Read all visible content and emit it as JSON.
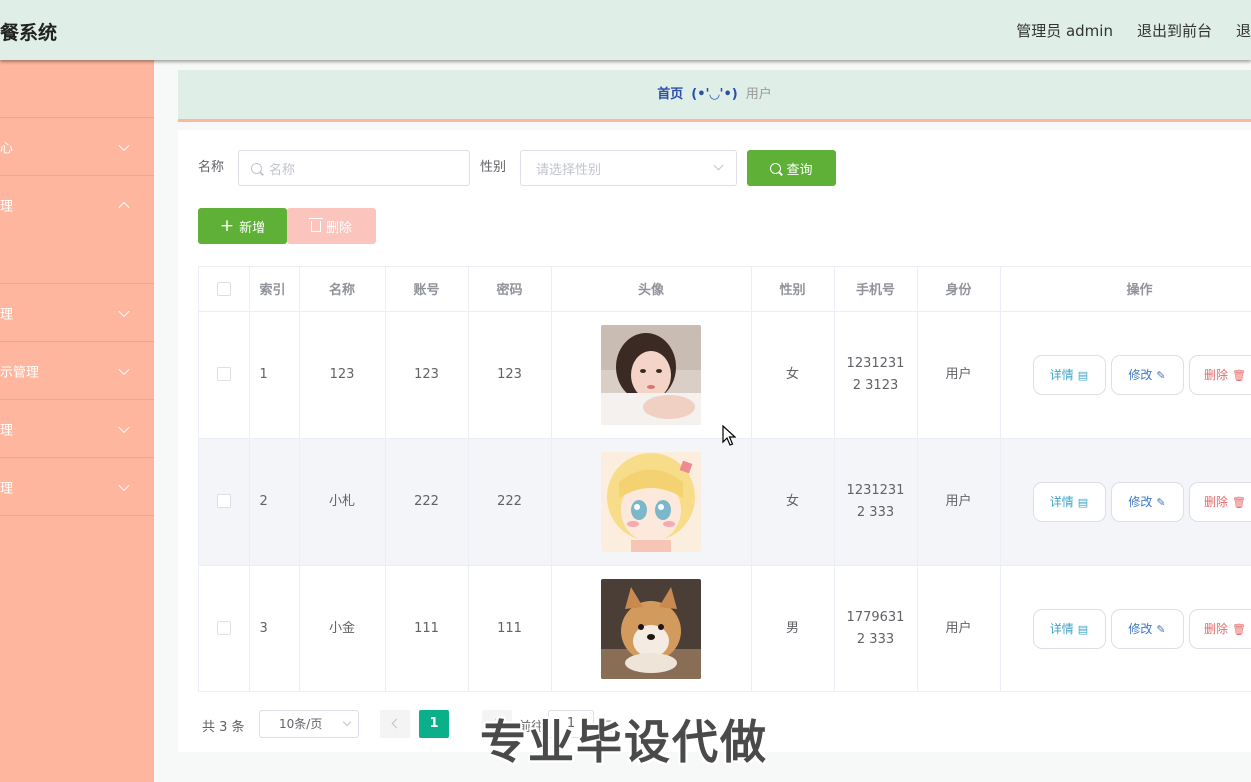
{
  "header": {
    "app_title": "餐系统",
    "admin_label": "管理员 admin",
    "exit_frontend": "退出到前台",
    "logout": "退"
  },
  "sidebar": {
    "items": [
      {
        "label": "",
        "chevron": "none"
      },
      {
        "label": "心",
        "chevron": "down"
      },
      {
        "label": "理",
        "chevron": "up"
      },
      {
        "label": "理",
        "chevron": "down"
      },
      {
        "label": "示管理",
        "chevron": "down"
      },
      {
        "label": "理",
        "chevron": "down"
      },
      {
        "label": "理",
        "chevron": "down"
      }
    ]
  },
  "breadcrumb": {
    "home": "首页",
    "face": "(•'◡'•)",
    "current": "用户"
  },
  "search": {
    "name_label": "名称",
    "name_placeholder": "名称",
    "name_value": "",
    "gender_label": "性别",
    "gender_placeholder": "请选择性别",
    "query_button": "查询"
  },
  "actions": {
    "add_button": "新增",
    "delete_button": "删除"
  },
  "table": {
    "columns": [
      "",
      "索引",
      "名称",
      "账号",
      "密码",
      "头像",
      "性别",
      "手机号",
      "身份",
      "操作"
    ],
    "rows": [
      {
        "index": "1",
        "name": "123",
        "account": "123",
        "password": "123",
        "avatar": "photo-girl",
        "gender": "女",
        "phone": "12312312 3123",
        "role": "用户"
      },
      {
        "index": "2",
        "name": "小札",
        "account": "222",
        "password": "222",
        "avatar": "anime-girl",
        "gender": "女",
        "phone": "12312312 333",
        "role": "用户"
      },
      {
        "index": "3",
        "name": "小金",
        "account": "111",
        "password": "111",
        "avatar": "shiba-dog",
        "gender": "男",
        "phone": "17796312 333",
        "role": "用户"
      }
    ],
    "op_detail": "详情",
    "op_edit": "修改",
    "op_delete": "删除"
  },
  "pagination": {
    "total": "共 3 条",
    "page_size": "10条/页",
    "current_page": "1",
    "goto_label": "前往",
    "goto_value": "1",
    "page_suffix": "页"
  },
  "overlay": {
    "watermark": "专业毕设代做"
  },
  "colors": {
    "header_bg": "#dfeee6",
    "sidebar_bg": "#ffb69e",
    "primary_green": "#5fb036",
    "pager_active": "#0bb08a",
    "delete_disabled": "#fbc4bd"
  }
}
